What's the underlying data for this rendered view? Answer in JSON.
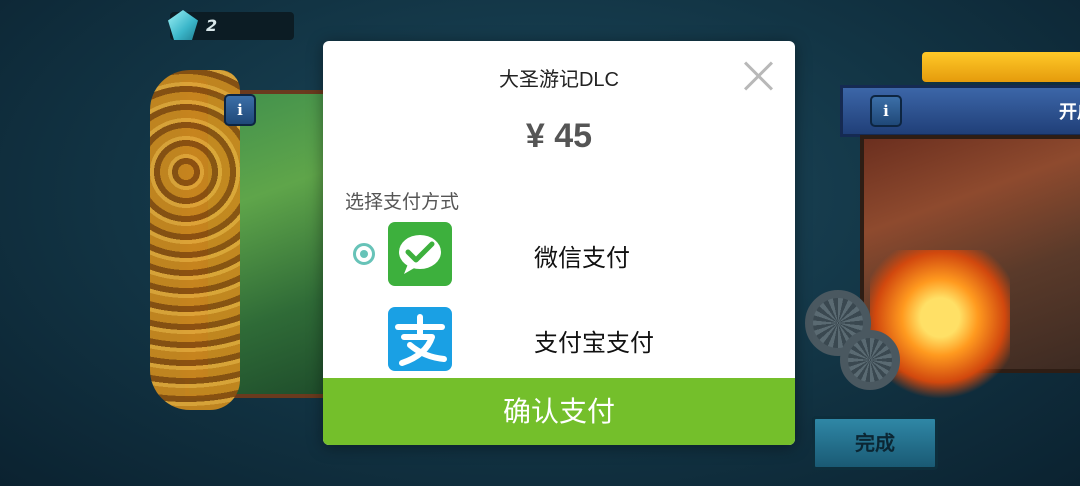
{
  "hud": {
    "gem_count": "2"
  },
  "background": {
    "info_icon_glyph": "i",
    "right_banner_text": "开启",
    "done_button_label": "完成"
  },
  "dialog": {
    "title": "大圣游记DLC",
    "price": "¥ 45",
    "section_label": "选择支付方式",
    "methods": [
      {
        "name": "wechat-pay",
        "label": "微信支付",
        "icon": "wechat-icon",
        "selected": true,
        "color": "#3db03d"
      },
      {
        "name": "alipay",
        "label": "支付宝支付",
        "icon": "alipay-icon",
        "selected": false,
        "color": "#1aa0e4"
      }
    ],
    "confirm_label": "确认支付",
    "confirm_color": "#74bf2b",
    "radio_color": "#67c3b8"
  }
}
